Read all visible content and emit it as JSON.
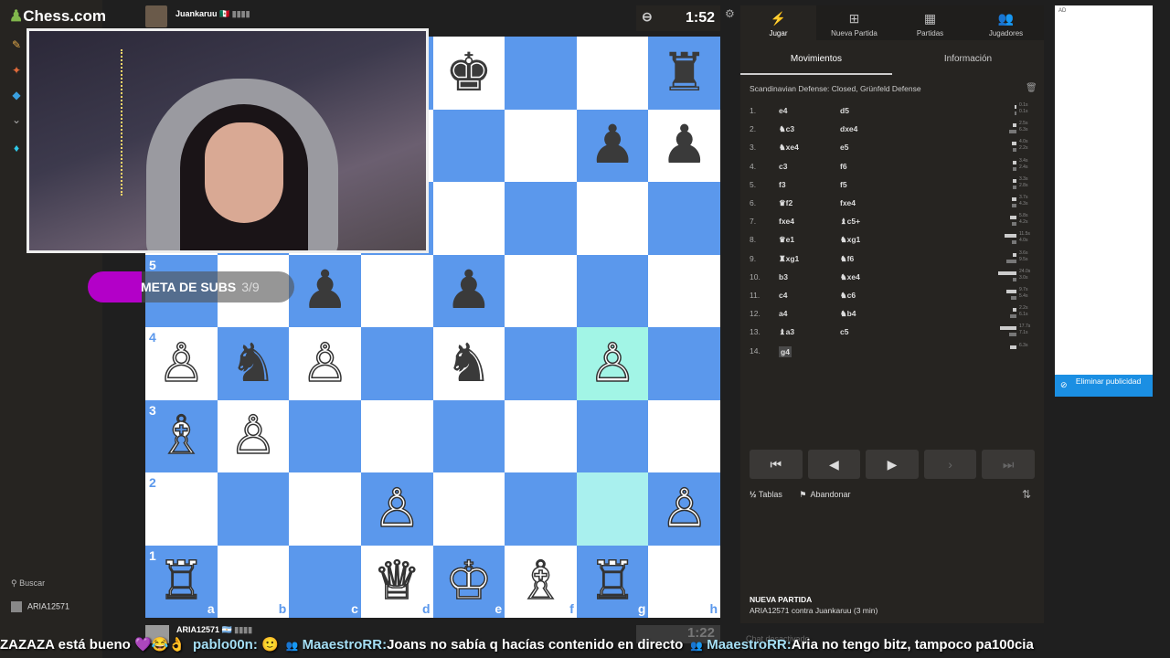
{
  "site": {
    "logo": "Chess.com"
  },
  "rail": {
    "search_label": "Buscar",
    "user_label": "ARIA12571"
  },
  "top_player": {
    "name": "Juankaruu",
    "flag": "🇲🇽",
    "clock": "1:52",
    "clock_icon": "⊖"
  },
  "bottom_player": {
    "name": "ARIA12571",
    "flag": "🇦🇷",
    "clock": "1:22"
  },
  "subs_goal": {
    "label": "META DE SUBS",
    "count": "3/9"
  },
  "board": {
    "ranks": [
      "5",
      "4",
      "3",
      "2",
      "1"
    ],
    "files": [
      "a",
      "b",
      "c",
      "d",
      "e",
      "f",
      "g",
      "h"
    ],
    "rows": [
      [
        [
          "lt",
          ""
        ],
        [
          "dk",
          ""
        ],
        [
          "lt",
          ""
        ],
        [
          "dk",
          ""
        ],
        [
          "lt",
          "♚b"
        ],
        [
          "dk",
          ""
        ],
        [
          "lt",
          ""
        ],
        [
          "dk",
          "♜b"
        ]
      ],
      [
        [
          "dk",
          ""
        ],
        [
          "lt",
          ""
        ],
        [
          "dk",
          ""
        ],
        [
          "lt",
          ""
        ],
        [
          "dk",
          ""
        ],
        [
          "lt",
          ""
        ],
        [
          "dk",
          "♟b"
        ],
        [
          "lt",
          "♟b"
        ]
      ],
      [
        [
          "lt",
          ""
        ],
        [
          "dk",
          ""
        ],
        [
          "lt",
          ""
        ],
        [
          "dk",
          ""
        ],
        [
          "lt",
          ""
        ],
        [
          "dk",
          ""
        ],
        [
          "lt",
          ""
        ],
        [
          "dk",
          ""
        ]
      ],
      [
        [
          "dk",
          ""
        ],
        [
          "lt",
          ""
        ],
        [
          "dk",
          "♟b"
        ],
        [
          "lt",
          ""
        ],
        [
          "dk",
          "♟b"
        ],
        [
          "lt",
          ""
        ],
        [
          "dk",
          ""
        ],
        [
          "lt",
          ""
        ]
      ],
      [
        [
          "lt",
          "♙w"
        ],
        [
          "dk",
          "♞b"
        ],
        [
          "lt",
          "♙w"
        ],
        [
          "dk",
          ""
        ],
        [
          "lt",
          "♞b"
        ],
        [
          "dk",
          ""
        ],
        [
          "hl",
          "♙w"
        ],
        [
          "dk",
          ""
        ]
      ],
      [
        [
          "dk",
          "♗w"
        ],
        [
          "lt",
          "♙w"
        ],
        [
          "dk",
          ""
        ],
        [
          "lt",
          ""
        ],
        [
          "dk",
          ""
        ],
        [
          "lt",
          ""
        ],
        [
          "dk",
          ""
        ],
        [
          "lt",
          ""
        ]
      ],
      [
        [
          "lt",
          ""
        ],
        [
          "dk",
          ""
        ],
        [
          "lt",
          ""
        ],
        [
          "dk",
          "♙w"
        ],
        [
          "lt",
          ""
        ],
        [
          "dk",
          ""
        ],
        [
          "hl2",
          ""
        ],
        [
          "dk",
          "♙w"
        ]
      ],
      [
        [
          "dk",
          "♖w"
        ],
        [
          "lt",
          ""
        ],
        [
          "dk",
          ""
        ],
        [
          "lt",
          "♕w"
        ],
        [
          "dk",
          "♔w"
        ],
        [
          "lt",
          "♗w"
        ],
        [
          "dk",
          "♖w"
        ],
        [
          "lt",
          ""
        ]
      ]
    ]
  },
  "nav_tabs": [
    {
      "label": "Jugar",
      "icon": "⚡"
    },
    {
      "label": "Nueva Partida",
      "icon": "⊞"
    },
    {
      "label": "Partidas",
      "icon": "▦"
    },
    {
      "label": "Jugadores",
      "icon": "👥"
    }
  ],
  "sub_tabs": [
    "Movimientos",
    "Información"
  ],
  "opening": "Scandinavian Defense: Closed, Grünfeld Defense",
  "moves": [
    {
      "n": "1.",
      "w": "e4",
      "b": "d5",
      "tw": "0.1s",
      "tb": "0.1s",
      "bw": 2,
      "bb": 2
    },
    {
      "n": "2.",
      "w": "♞c3",
      "b": "dxe4",
      "tw": "2.5s",
      "tb": "6.3s",
      "bw": 4,
      "bb": 8
    },
    {
      "n": "3.",
      "w": "♞xe4",
      "b": "e5",
      "tw": "4.0s",
      "tb": "2.2s",
      "bw": 5,
      "bb": 4
    },
    {
      "n": "4.",
      "w": "c3",
      "b": "f6",
      "tw": "3.4s",
      "tb": "2.4s",
      "bw": 4,
      "bb": 4
    },
    {
      "n": "5.",
      "w": "f3",
      "b": "f5",
      "tw": "3.3s",
      "tb": "2.8s",
      "bw": 4,
      "bb": 4
    },
    {
      "n": "6.",
      "w": "♛f2",
      "b": "fxe4",
      "tw": "3.7s",
      "tb": "4.3s",
      "bw": 5,
      "bb": 5
    },
    {
      "n": "7.",
      "w": "fxe4",
      "b": "♝c5+",
      "tw": "5.8s",
      "tb": "4.2s",
      "bw": 7,
      "bb": 5
    },
    {
      "n": "8.",
      "w": "♛e1",
      "b": "♞xg1",
      "tw": "11.5s",
      "tb": "4.0s",
      "bw": 13,
      "bb": 5
    },
    {
      "n": "9.",
      "w": "♜xg1",
      "b": "♞f6",
      "tw": "3.6s",
      "tb": "9.5s",
      "bw": 4,
      "bb": 11
    },
    {
      "n": "10.",
      "w": "b3",
      "b": "♞xe4",
      "tw": "24.0s",
      "tb": "3.0s",
      "bw": 20,
      "bb": 4
    },
    {
      "n": "11.",
      "w": "c4",
      "b": "♞c6",
      "tw": "9.7s",
      "tb": "5.4s",
      "bw": 11,
      "bb": 6
    },
    {
      "n": "12.",
      "w": "a4",
      "b": "♞b4",
      "tw": "2.2s",
      "tb": "6.1s",
      "bw": 4,
      "bb": 7
    },
    {
      "n": "13.",
      "w": "♝a3",
      "b": "c5",
      "tw": "17.7s",
      "tb": "7.1s",
      "bw": 18,
      "bb": 8
    },
    {
      "n": "14.",
      "w": "g4",
      "b": "",
      "tw": "6.3s",
      "tb": "",
      "bw": 7,
      "bb": 0
    }
  ],
  "controls": [
    "⏮",
    "◀",
    "▶",
    "›",
    "⏭"
  ],
  "actions": {
    "draw_icon": "½",
    "draw": "Tablas",
    "resign_icon": "⚑",
    "resign": "Abandonar"
  },
  "new_game": {
    "title": "NUEVA PARTIDA",
    "desc": "ARIA12571 contra Juankaruu (3 min)"
  },
  "chat": {
    "disabled": "Chat desactivado"
  },
  "ad": {
    "tag": "AD",
    "remove": "Eliminar publicidad"
  },
  "ticker": [
    {
      "t": "ZAZAZA está bueno 💜😂👌"
    },
    {
      "u": "pablo00n:",
      "t": " 🙂"
    },
    {
      "b": "👥",
      "u": "MaaestroRR:",
      "t": "Joans no sabía q hacías contenido en directo"
    },
    {
      "b": "👥",
      "u": "MaaestroRR:",
      "t": "Aria no tengo bitz, tampoco pa100cia"
    }
  ],
  "colors": {
    "light_square": "#ffffff",
    "dark_square": "#5b98ec",
    "highlight": "#a2f5e6",
    "accent": "#b300c8"
  }
}
